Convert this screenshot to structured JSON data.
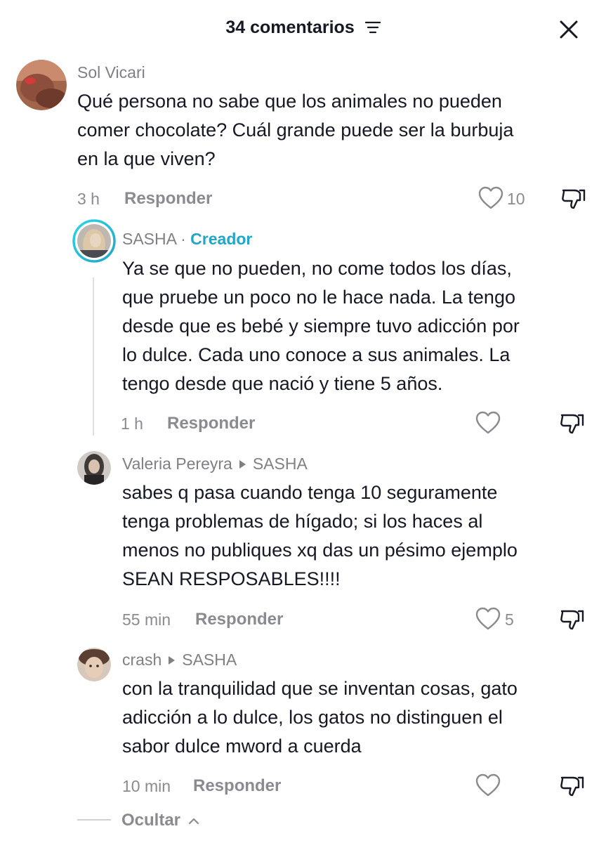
{
  "header": {
    "title": "34 comentarios",
    "filter_icon": "filter-lines-icon",
    "close_icon": "close-x-icon"
  },
  "comments": [
    {
      "username": "Sol Vicari",
      "lines": [
        "Qué persona no sabe que los animales no pueden",
        "comer chocolate? Cuál grande puede ser la burbuja",
        "en la que viven?"
      ],
      "time": "3 h",
      "reply_label": "Responder",
      "likes": "10"
    },
    {
      "username": "SASHA",
      "separator": "·",
      "badge": "Creador",
      "lines": [
        "Ya se que no pueden, no come todos los días,",
        "que pruebe un poco no le hace nada. La tengo",
        "desde que es bebé y siempre tuvo adicción por",
        "lo dulce. Cada uno conoce a sus animales. La",
        "tengo desde que nació y tiene 5 años."
      ],
      "time": "1 h",
      "reply_label": "Responder",
      "likes": ""
    },
    {
      "username": "Valeria Pereyra",
      "reply_to": "SASHA",
      "lines": [
        "sabes q pasa cuando tenga 10 seguramente",
        "tenga problemas de hígado; si los haces al",
        "menos no publiques xq das un pésimo ejemplo",
        "SEAN RESPOSABLES!!!!"
      ],
      "time": "55 min",
      "reply_label": "Responder",
      "likes": "5"
    },
    {
      "username": "crash",
      "reply_to": "SASHA",
      "lines": [
        "con la tranquilidad que se inventan cosas, gato",
        "adicción a lo dulce, los gatos no distinguen el",
        "sabor dulce mword a cuerda"
      ],
      "time": "10 min",
      "reply_label": "Responder",
      "likes": ""
    }
  ],
  "footer": {
    "hide_label": "Ocultar"
  },
  "colors": {
    "text": "#161823",
    "muted": "#8a8b91",
    "creator": "#21a6c9"
  }
}
